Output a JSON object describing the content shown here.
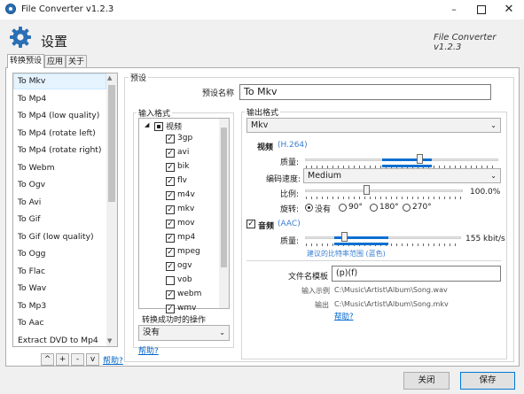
{
  "window": {
    "title": "File Converter v1.2.3",
    "minimize_icon": "minimize-icon",
    "maximize_icon": "maximize-icon",
    "close_icon": "close-icon"
  },
  "header": {
    "title": "设置",
    "version": "File Converter v1.2.3",
    "icon": "gear-icon",
    "accent": "#2a6fb5"
  },
  "tabs": [
    {
      "label": "转换预设"
    },
    {
      "label": "应用"
    },
    {
      "label": "关于"
    }
  ],
  "presets": {
    "items": [
      "To Mkv",
      "To Mp4",
      "To Mp4 (low quality)",
      "To Mp4 (rotate left)",
      "To Mp4 (rotate right)",
      "To Webm",
      "To Ogv",
      "To Avi",
      "To Gif",
      "To Gif (low quality)",
      "To Ogg",
      "To Flac",
      "To Wav",
      "To Mp3",
      "To Aac",
      "Extract DVD to Mp4"
    ],
    "selected_index": 0,
    "buttons": [
      "^",
      "+",
      "-",
      "v"
    ],
    "help_label": "帮助?"
  },
  "preset_group": {
    "title": "预设",
    "name_label": "预设名称",
    "name_value": "To Mkv"
  },
  "input_formats": {
    "title": "输入格式",
    "category": "视频",
    "items": [
      {
        "name": "3gp",
        "checked": true
      },
      {
        "name": "avi",
        "checked": true
      },
      {
        "name": "bik",
        "checked": true
      },
      {
        "name": "flv",
        "checked": true
      },
      {
        "name": "m4v",
        "checked": true
      },
      {
        "name": "mkv",
        "checked": true
      },
      {
        "name": "mov",
        "checked": true
      },
      {
        "name": "mp4",
        "checked": true
      },
      {
        "name": "mpeg",
        "checked": true
      },
      {
        "name": "ogv",
        "checked": true
      },
      {
        "name": "vob",
        "checked": false
      },
      {
        "name": "webm",
        "checked": true
      },
      {
        "name": "wmv",
        "checked": true
      }
    ],
    "on_success_label": "转换成功时的操作",
    "on_success_value": "没有",
    "help_label": "帮助?"
  },
  "output": {
    "title": "输出格式",
    "format": "Mkv",
    "video_label": "视频",
    "video_codec": "(H.264)",
    "quality_label": "质量:",
    "speed_label": "编码速度:",
    "speed_value": "Medium",
    "scale_label": "比例:",
    "scale_value": "100.0%",
    "rotate_label": "旋转:",
    "rotate_options": [
      "没有",
      "90°",
      "180°",
      "270°"
    ],
    "rotate_selected": 0,
    "audio_label": "音频",
    "audio_checked": true,
    "audio_codec": "(AAC)",
    "audio_quality_label": "质量:",
    "audio_quality_value": "155 kbit/s",
    "bitrate_hint": "建议的比特率范围 (蓝色)",
    "template_label": "文件名模板",
    "template_value": "(p)(f)",
    "input_example_label": "输入示例",
    "input_example_value": "C:\\Music\\Artist\\Album\\Song.wav",
    "output_example_label": "输出",
    "output_example_value": "C:\\Music\\Artist\\Album\\Song.mkv",
    "help_label": "帮助?"
  },
  "footer": {
    "close_label": "关闭",
    "save_label": "保存"
  },
  "levels": {
    "video_quality_fraction": 0.59,
    "scale_fraction": 0.39,
    "audio_quality_fraction": 0.25
  }
}
